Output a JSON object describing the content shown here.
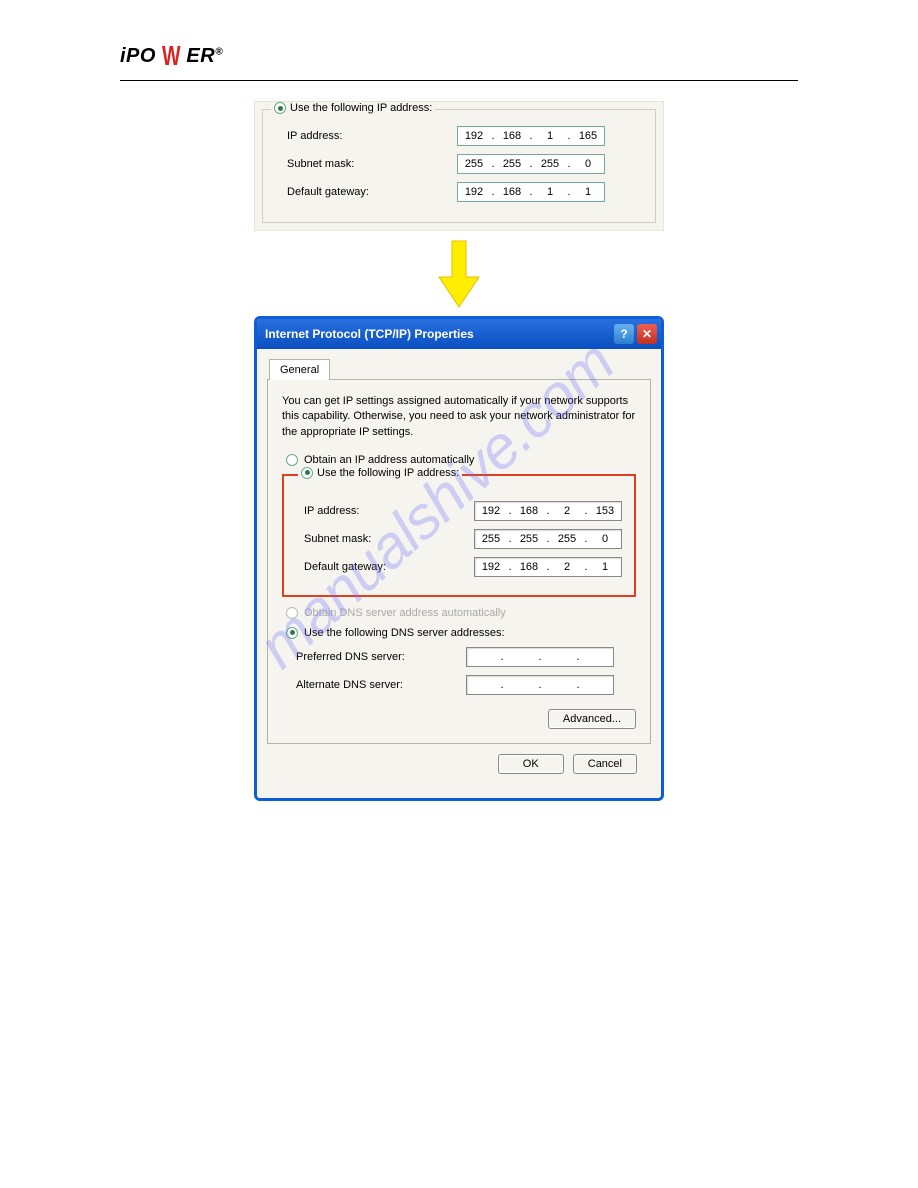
{
  "logo": {
    "text_left": "iPO",
    "text_right": "ER",
    "reg": "®"
  },
  "watermark": "manualshive.com",
  "top_panel": {
    "legend": "Use the following IP address:",
    "fields": [
      {
        "label": "IP address:",
        "oct": [
          "192",
          "168",
          "1",
          "165"
        ]
      },
      {
        "label": "Subnet mask:",
        "oct": [
          "255",
          "255",
          "255",
          "0"
        ]
      },
      {
        "label": "Default gateway:",
        "oct": [
          "192",
          "168",
          "1",
          "1"
        ]
      }
    ]
  },
  "dialog": {
    "title": "Internet Protocol (TCP/IP) Properties",
    "tab": "General",
    "description": "You can get IP settings assigned automatically if your network supports this capability. Otherwise, you need to ask your network administrator for the appropriate IP settings.",
    "radio_auto_ip": "Obtain an IP address automatically",
    "radio_manual_ip": "Use the following IP address:",
    "ip_fields": [
      {
        "label": "IP address:",
        "oct": [
          "192",
          "168",
          "2",
          "153"
        ]
      },
      {
        "label": "Subnet mask:",
        "oct": [
          "255",
          "255",
          "255",
          "0"
        ]
      },
      {
        "label": "Default gateway:",
        "oct": [
          "192",
          "168",
          "2",
          "1"
        ]
      }
    ],
    "radio_auto_dns": "Obtain DNS server address automatically",
    "radio_manual_dns": "Use the following DNS server addresses:",
    "dns_fields": [
      {
        "label": "Preferred DNS server:",
        "oct": [
          "",
          "",
          "",
          ""
        ]
      },
      {
        "label": "Alternate DNS server:",
        "oct": [
          "",
          "",
          "",
          ""
        ]
      }
    ],
    "advanced_btn": "Advanced...",
    "ok_btn": "OK",
    "cancel_btn": "Cancel"
  }
}
